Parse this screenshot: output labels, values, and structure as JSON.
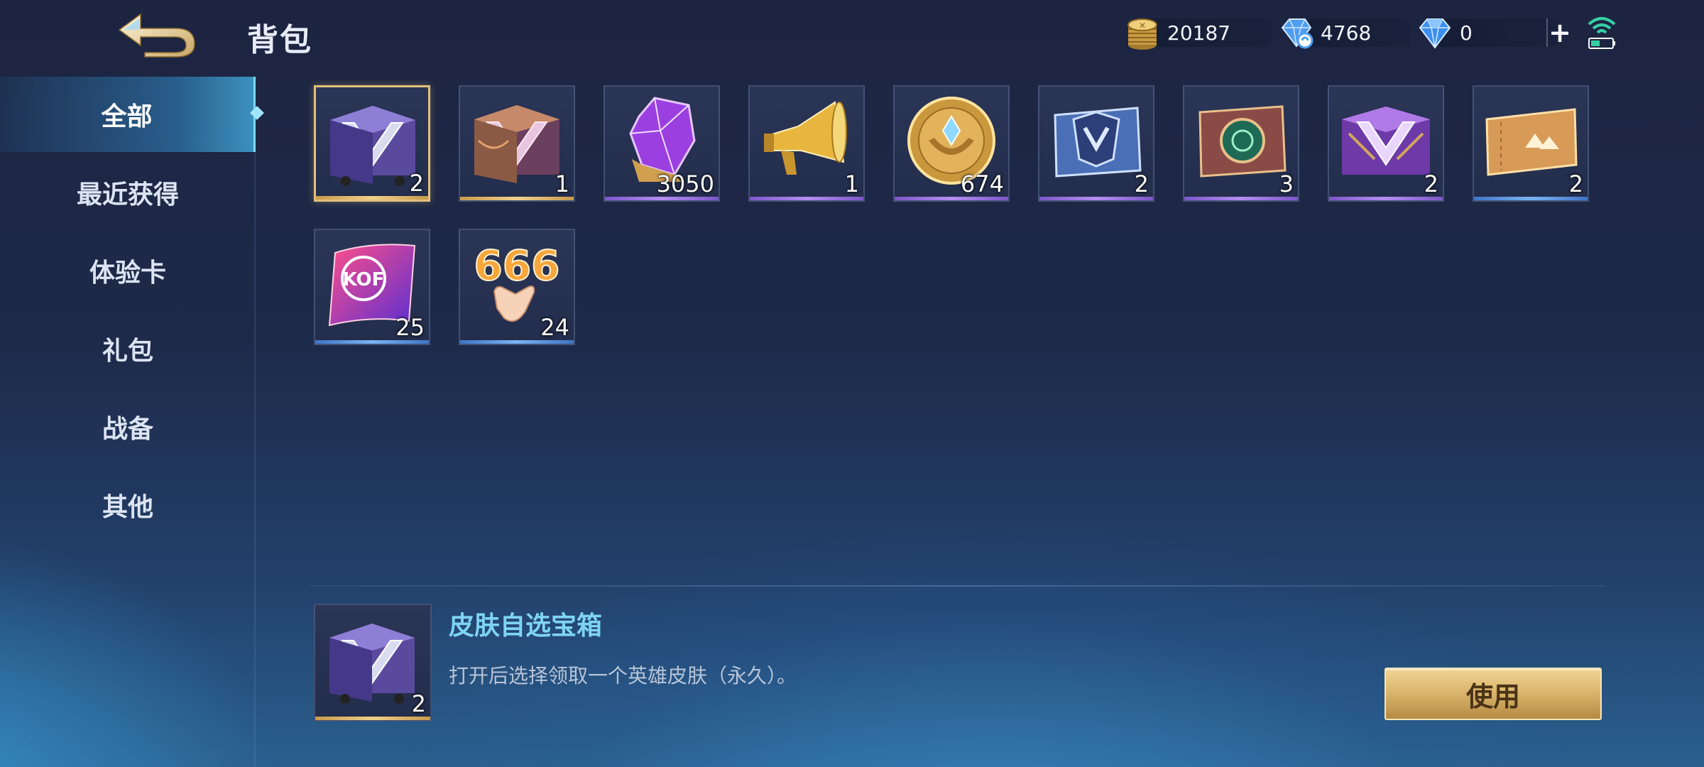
{
  "header": {
    "title": "背包",
    "back_icon": "back-arrow-icon"
  },
  "currencies": [
    {
      "name": "gold-coin",
      "icon": "gold-coin-icon",
      "value": "20187"
    },
    {
      "name": "voucher",
      "icon": "voucher-crystal-icon",
      "value": "4768"
    },
    {
      "name": "diamond",
      "icon": "diamond-icon",
      "value": "0"
    }
  ],
  "add_label": "+",
  "status": {
    "icon": "wifi-signal-icon"
  },
  "sidebar": {
    "items": [
      {
        "label": "全部",
        "active": true
      },
      {
        "label": "最近获得",
        "active": false
      },
      {
        "label": "体验卡",
        "active": false
      },
      {
        "label": "礼包",
        "active": false
      },
      {
        "label": "战备",
        "active": false
      },
      {
        "label": "其他",
        "active": false
      }
    ]
  },
  "inventory": [
    {
      "icon": "skin-chest-icon",
      "qty": "2",
      "rarity": "gold",
      "selected": true
    },
    {
      "icon": "skin-chest-icon",
      "qty": "1",
      "rarity": "gold",
      "selected": false
    },
    {
      "icon": "purple-crystal-icon",
      "qty": "3050",
      "rarity": "purple",
      "selected": false
    },
    {
      "icon": "megaphone-icon",
      "qty": "1",
      "rarity": "purple",
      "selected": false
    },
    {
      "icon": "gold-medal-icon",
      "qty": "674",
      "rarity": "purple",
      "selected": false
    },
    {
      "icon": "emblem-card-icon",
      "qty": "2",
      "rarity": "purple",
      "selected": false
    },
    {
      "icon": "badge-card-icon",
      "qty": "3",
      "rarity": "purple",
      "selected": false
    },
    {
      "icon": "purple-chest-icon",
      "qty": "2",
      "rarity": "purple",
      "selected": false
    },
    {
      "icon": "ticket-icon",
      "qty": "2",
      "rarity": "blue",
      "selected": false
    },
    {
      "icon": "kof-card-icon",
      "qty": "25",
      "rarity": "blue",
      "selected": false
    },
    {
      "icon": "666-emote-icon",
      "qty": "24",
      "rarity": "blue",
      "selected": false
    }
  ],
  "detail": {
    "icon": "skin-chest-icon",
    "name": "皮肤自选宝箱",
    "qty": "2",
    "description": "打开后选择领取一个英雄皮肤（永久）。",
    "use_label": "使用"
  }
}
